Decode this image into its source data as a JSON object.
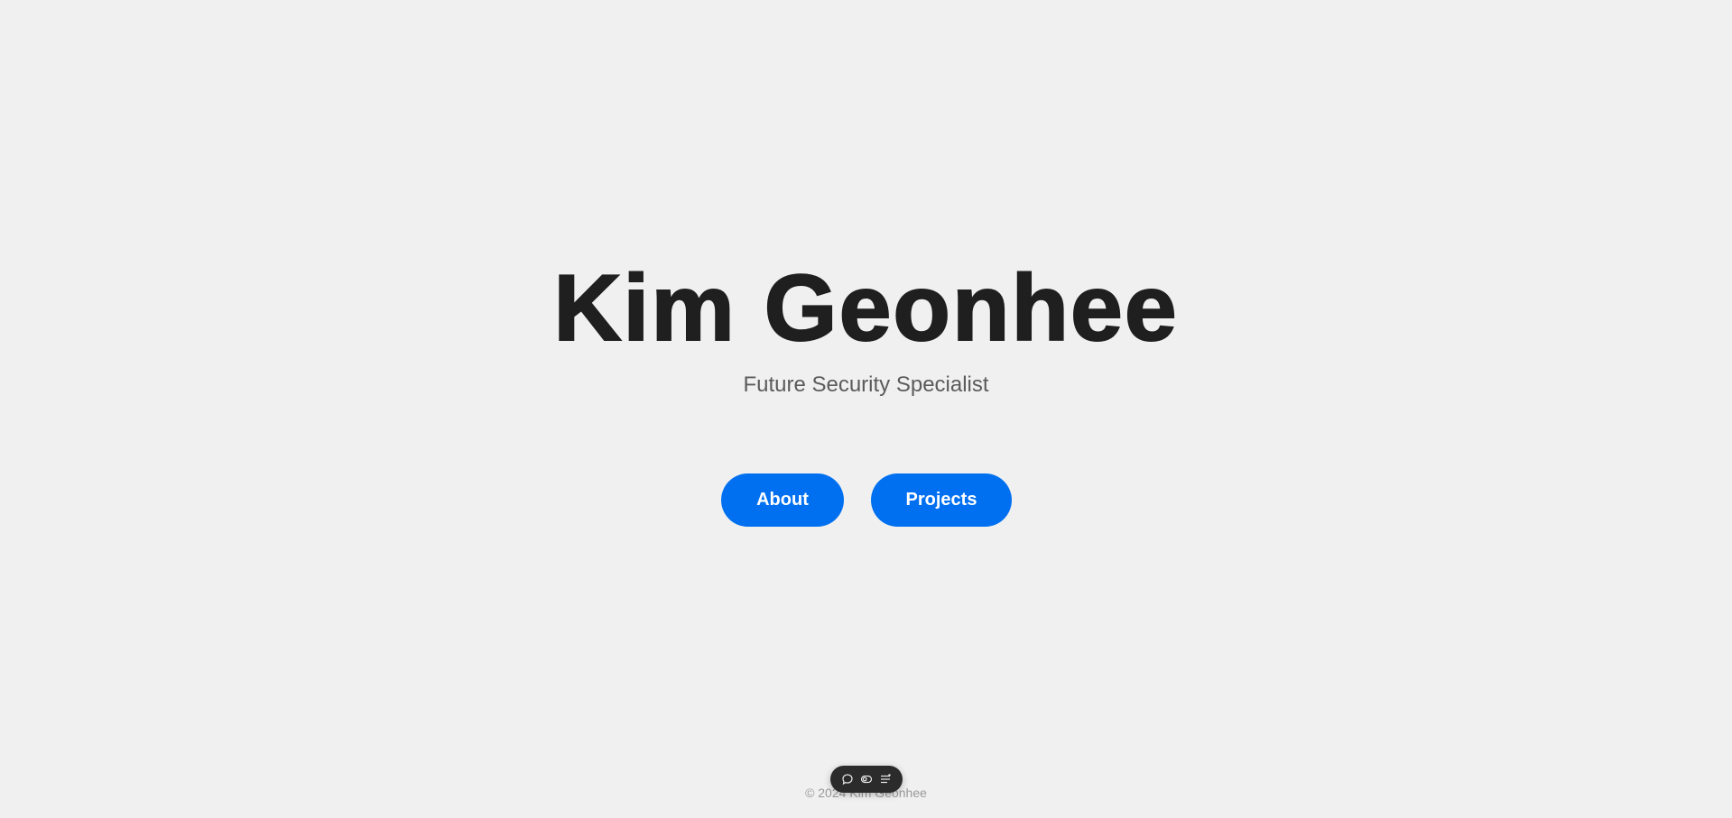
{
  "hero": {
    "title": "Kim Geonhee",
    "subtitle": "Future Security Specialist"
  },
  "nav": {
    "about_label": "About",
    "projects_label": "Projects"
  },
  "footer": {
    "copyright": "© 2024 Kim Geonhee"
  },
  "toolbar": {
    "icons": [
      "comment-icon",
      "toggle-icon",
      "menu-list-icon"
    ]
  },
  "colors": {
    "background": "#f0f0f0",
    "title": "#1f1f1f",
    "subtitle": "#5b5b5b",
    "accent": "#0070f0",
    "footer_text": "#9a9a9a",
    "toolbar_bg": "#2b2b2b"
  }
}
